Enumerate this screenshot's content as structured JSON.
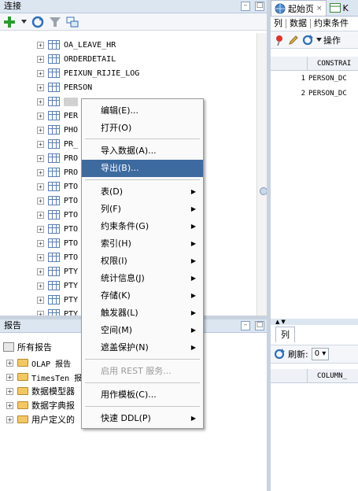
{
  "connections": {
    "title": "连接",
    "tree_items": [
      "OA_LEAVE_HR",
      "ORDERDETAIL",
      "PEIXUN_RIJIE_LOG",
      "PERSON",
      "PER",
      "PER",
      "PHO",
      "PR_",
      "PRO",
      "PRO",
      "PTO",
      "PTO",
      "PTO",
      "PTO",
      "PTO",
      "PTO",
      "PTY",
      "PTY",
      "PTY",
      "PTY"
    ]
  },
  "reports": {
    "title": "报告",
    "root": "所有报告",
    "items": [
      "OLAP 报告",
      "TimesTen 报",
      "数据模型器",
      "数据字典报",
      "用户定义的"
    ]
  },
  "editor": {
    "tabs": [
      "起始页",
      "K"
    ],
    "subtabs": [
      "列",
      "数据",
      "约束条件"
    ],
    "actions_label": "操作",
    "grid_header": "CONSTRAI",
    "rows": [
      {
        "num": "1",
        "value": "PERSON_DC"
      },
      {
        "num": "2",
        "value": "PERSON_DC"
      }
    ],
    "lower_tab": "列",
    "refresh_label": "刷新:",
    "refresh_value": "0",
    "lower_header": "COLUMN_"
  },
  "context_menu": {
    "items": [
      {
        "label": "编辑(E)...",
        "submenu": false,
        "state": "normal"
      },
      {
        "label": "打开(O)",
        "submenu": false,
        "state": "normal"
      },
      {
        "label": "导入数据(A)...",
        "submenu": false,
        "state": "normal"
      },
      {
        "label": "导出(B)...",
        "submenu": false,
        "state": "highlighted"
      },
      {
        "label": "表(D)",
        "submenu": true,
        "state": "normal"
      },
      {
        "label": "列(F)",
        "submenu": true,
        "state": "normal"
      },
      {
        "label": "约束条件(G)",
        "submenu": true,
        "state": "normal"
      },
      {
        "label": "索引(H)",
        "submenu": true,
        "state": "normal"
      },
      {
        "label": "权限(I)",
        "submenu": true,
        "state": "normal"
      },
      {
        "label": "统计信息(J)",
        "submenu": true,
        "state": "normal"
      },
      {
        "label": "存储(K)",
        "submenu": true,
        "state": "normal"
      },
      {
        "label": "触发器(L)",
        "submenu": true,
        "state": "normal"
      },
      {
        "label": "空间(M)",
        "submenu": true,
        "state": "normal"
      },
      {
        "label": "遮盖保护(N)",
        "submenu": true,
        "state": "normal"
      },
      {
        "label": "启用 REST 服务...",
        "submenu": false,
        "state": "disabled"
      },
      {
        "label": "用作模板(C)...",
        "submenu": false,
        "state": "normal"
      },
      {
        "label": "快速 DDL(P)",
        "submenu": true,
        "state": "normal"
      }
    ]
  },
  "colors": {
    "menu_highlight": "#3d6a9f",
    "panel_title": "#dce6f1"
  }
}
